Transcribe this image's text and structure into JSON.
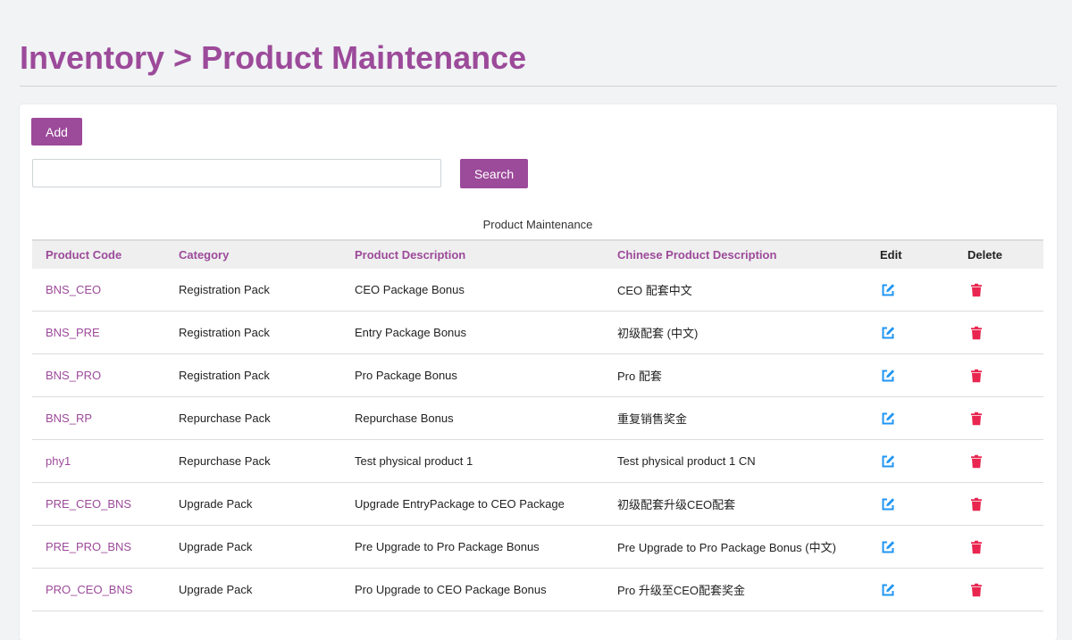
{
  "header": {
    "title": "Inventory > Product Maintenance"
  },
  "toolbar": {
    "add_label": "Add",
    "search_label": "Search",
    "search_placeholder": "",
    "search_value": ""
  },
  "table": {
    "caption": "Product Maintenance",
    "headers": {
      "code": "Product Code",
      "category": "Category",
      "description": "Product Description",
      "cn_description": "Chinese Product Description",
      "edit": "Edit",
      "delete": "Delete"
    },
    "rows": [
      {
        "code": "BNS_CEO",
        "category": "Registration Pack",
        "description": "CEO Package Bonus",
        "cn_description": "CEO 配套中文"
      },
      {
        "code": "BNS_PRE",
        "category": "Registration Pack",
        "description": "Entry Package Bonus",
        "cn_description": "初级配套 (中文)"
      },
      {
        "code": "BNS_PRO",
        "category": "Registration Pack",
        "description": "Pro Package Bonus",
        "cn_description": "Pro 配套"
      },
      {
        "code": "BNS_RP",
        "category": "Repurchase Pack",
        "description": "Repurchase Bonus",
        "cn_description": "重复销售奖金"
      },
      {
        "code": "phy1",
        "category": "Repurchase Pack",
        "description": "Test physical product 1",
        "cn_description": "Test physical product 1 CN"
      },
      {
        "code": "PRE_CEO_BNS",
        "category": "Upgrade Pack",
        "description": "Upgrade EntryPackage to CEO Package",
        "cn_description": "初级配套升级CEO配套"
      },
      {
        "code": "PRE_PRO_BNS",
        "category": "Upgrade Pack",
        "description": "Pre Upgrade to Pro Package Bonus",
        "cn_description": "Pre Upgrade to Pro Package Bonus (中文)"
      },
      {
        "code": "PRO_CEO_BNS",
        "category": "Upgrade Pack",
        "description": "Pro Upgrade to CEO Package Bonus",
        "cn_description": "Pro 升级至CEO配套奖金"
      }
    ]
  },
  "colors": {
    "accent": "#9c4a9a",
    "edit_icon": "#2196f3",
    "delete_icon": "#e8264f"
  },
  "icons": {
    "edit": "edit-icon",
    "delete": "trash-icon"
  }
}
